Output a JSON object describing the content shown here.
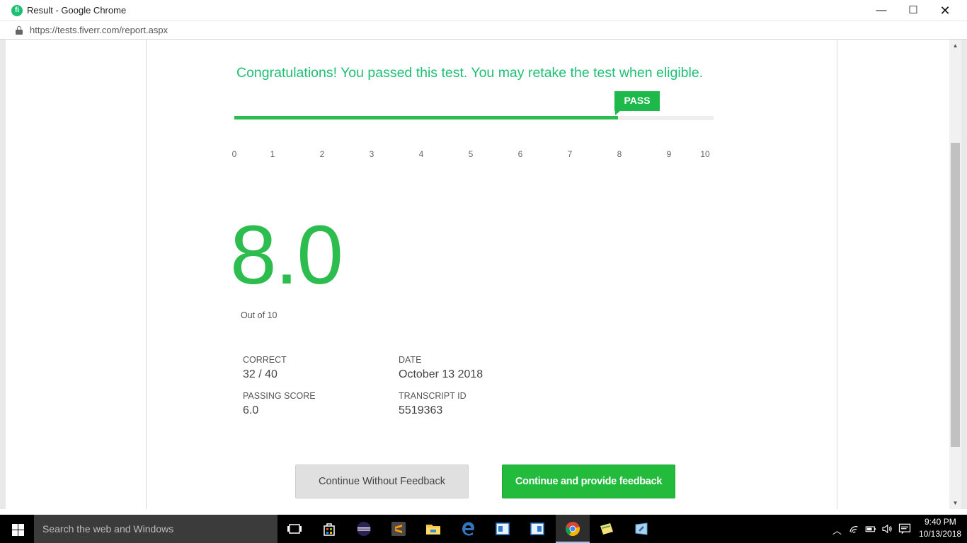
{
  "window": {
    "title": "Result - Google Chrome",
    "favicon_letter": "fi",
    "minimize_glyph": "—",
    "maximize_glyph": "☐",
    "close_glyph": "✕"
  },
  "addressbar": {
    "url": "https://tests.fiverr.com/report.aspx"
  },
  "result": {
    "message": "Congratulations! You passed this test. You may retake the test when eligible.",
    "badge": "PASS",
    "progress_value": 8.0,
    "progress_max": 10,
    "ticks": [
      "0",
      "1",
      "2",
      "3",
      "4",
      "5",
      "6",
      "7",
      "8",
      "9",
      "10"
    ],
    "score": "8.0",
    "score_caption": "Out of 10"
  },
  "stats": {
    "correct_label": "CORRECT",
    "correct_value": "32 / 40",
    "date_label": "DATE",
    "date_value": "October 13 2018",
    "passing_label": "PASSING SCORE",
    "passing_value": "6.0",
    "transcript_label": "TRANSCRIPT ID",
    "transcript_value": "5519363"
  },
  "buttons": {
    "without_feedback": "Continue Without Feedback",
    "with_feedback": "Continue and provide feedback"
  },
  "taskbar": {
    "search_placeholder": "Search the web and Windows",
    "time": "9:40 PM",
    "date": "10/13/2018"
  },
  "colors": {
    "brand_green": "#1dbf73",
    "pass_green": "#2dbd4e",
    "button_green": "#22bb3c"
  }
}
